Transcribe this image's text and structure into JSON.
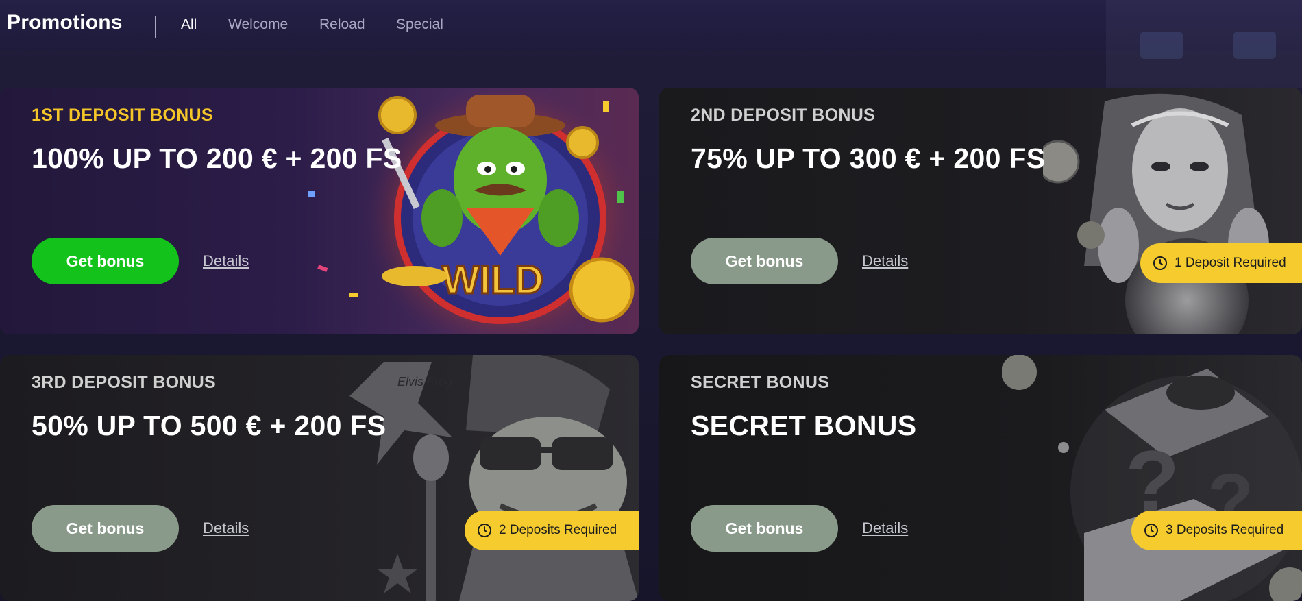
{
  "header": {
    "title": "Promotions",
    "tabs": [
      {
        "label": "All",
        "active": true
      },
      {
        "label": "Welcome",
        "active": false
      },
      {
        "label": "Reload",
        "active": false
      },
      {
        "label": "Special",
        "active": false
      }
    ]
  },
  "cards": [
    {
      "eyebrow": "1ST DEPOSIT BONUS",
      "headline": "100% UP TO 200 € + 200 FS",
      "button_label": "Get bonus",
      "details_label": "Details",
      "badge": "",
      "image_text": "WILD",
      "artwork": "cactus-cowboy-wild"
    },
    {
      "eyebrow": "2ND DEPOSIT BONUS",
      "headline": "75% UP TO 300 € + 200 FS",
      "button_label": "Get bonus",
      "details_label": "Details",
      "badge": "1 Deposit Required",
      "artwork": "fortune-teller"
    },
    {
      "eyebrow": "3RD DEPOSIT BONUS",
      "headline": "50% UP TO 500 € + 200 FS",
      "button_label": "Get bonus",
      "details_label": "Details",
      "badge": "2 Deposits Required",
      "image_text": "Elvis Frog",
      "artwork": "elvis-frog"
    },
    {
      "eyebrow": "SECRET BONUS",
      "headline": "SECRET BONUS",
      "button_label": "Get bonus",
      "details_label": "Details",
      "badge": "3 Deposits Required",
      "artwork": "mystery-gift-box"
    }
  ],
  "colors": {
    "accent_yellow": "#f5cb2d",
    "primary_button_green": "#13c21b",
    "disabled_button": "#8a9a8a",
    "header_bg": "#242046"
  },
  "icons": {
    "badge": "clock-icon"
  }
}
